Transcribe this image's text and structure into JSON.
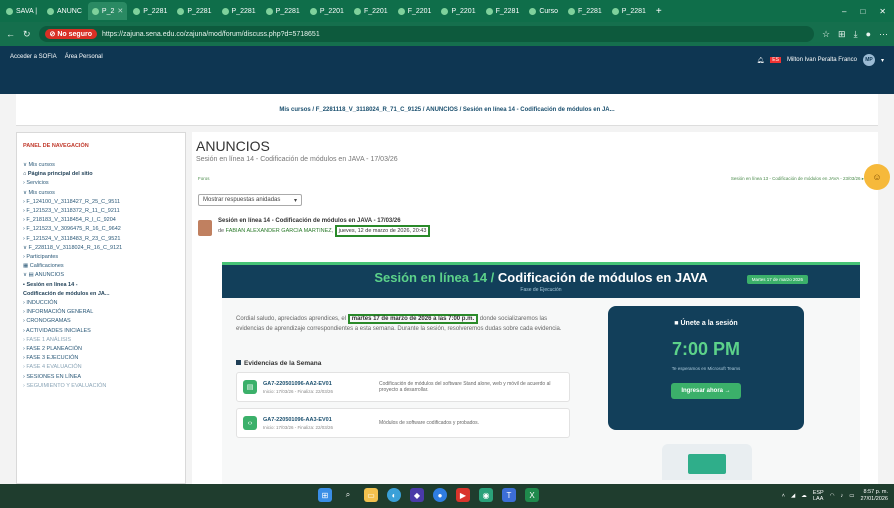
{
  "browser": {
    "tabs": [
      {
        "label": "SAVA |",
        "active": false
      },
      {
        "label": "ANUNC",
        "active": false
      },
      {
        "label": "P_2",
        "active": true
      },
      {
        "label": "P_2281",
        "active": false
      },
      {
        "label": "P_2281",
        "active": false
      },
      {
        "label": "P_2281",
        "active": false
      },
      {
        "label": "P_2281",
        "active": false
      },
      {
        "label": "P_2201",
        "active": false
      },
      {
        "label": "F_2201",
        "active": false
      },
      {
        "label": "F_2201",
        "active": false
      },
      {
        "label": "P_2201",
        "active": false
      },
      {
        "label": "F_2281",
        "active": false
      },
      {
        "label": "Curso",
        "active": false
      },
      {
        "label": "F_2281",
        "active": false
      },
      {
        "label": "P_2281",
        "active": false
      }
    ],
    "new_tab": "+",
    "window_controls": [
      "–",
      "□",
      "✕"
    ],
    "not_secure_label": "No seguro",
    "url": "https://zajuna.sena.edu.co/zajuna/mod/forum/discuss.php?d=5718651"
  },
  "moodle": {
    "top_links": [
      "Acceder a SOFIA",
      "Área Personal"
    ],
    "user_name": "Milton Ivan Peralta Franco",
    "user_initials": "MP",
    "breadcrumb": "Mis cursos / F_2281118_V_3118024_R_71_C_9125 / ANUNCIOS / Sesión en línea 14 - Codificación de módulos en JA..."
  },
  "sidebar": {
    "header": "PANEL DE NAVEGACIÓN",
    "items": [
      {
        "label": "∨ Mis cursos",
        "style": ""
      },
      {
        "label": "⌂ Página principal del sitio",
        "style": "bold"
      },
      {
        "label": "› Servicios",
        "style": ""
      },
      {
        "label": "∨ Mis cursos",
        "style": ""
      },
      {
        "label": "› F_124100_V_3118427_R_25_C_9511",
        "style": ""
      },
      {
        "label": "› F_121523_V_3118372_R_11_C_9211",
        "style": ""
      },
      {
        "label": "› F_218183_V_3118454_R_I_C_9204",
        "style": ""
      },
      {
        "label": "› F_121523_V_3096475_R_16_C_9642",
        "style": ""
      },
      {
        "label": "› F_121524_V_3118483_R_23_C_9521",
        "style": ""
      },
      {
        "label": "∨ F_228118_V_3118024_R_16_C_9121",
        "style": ""
      },
      {
        "label": "   › Participantes",
        "style": ""
      },
      {
        "label": "   ▦ Calificaciones",
        "style": ""
      },
      {
        "label": "   ∨ ▤ ANUNCIOS",
        "style": ""
      },
      {
        "label": "      ▪ Sesión en línea 14 -",
        "style": "bold"
      },
      {
        "label": "      Codificación de módulos en JA...",
        "style": "bold"
      },
      {
        "label": "   › INDUCCIÓN",
        "style": ""
      },
      {
        "label": "   › INFORMACIÓN GENERAL",
        "style": ""
      },
      {
        "label": "   › CRONOGRAMAS",
        "style": ""
      },
      {
        "label": "   › ACTIVIDADES INICIALES",
        "style": ""
      },
      {
        "label": "   › FASE 1 ANÁLISIS",
        "style": "grey"
      },
      {
        "label": "   › FASE 2 PLANEACIÓN",
        "style": ""
      },
      {
        "label": "   › FASE 3 EJECUCIÓN",
        "style": ""
      },
      {
        "label": "   › FASE 4 EVALUACIÓN",
        "style": "grey"
      },
      {
        "label": "   › SESIONES EN LÍNEA",
        "style": ""
      },
      {
        "label": "   › SEGUIMIENTO Y EVALUACIÓN",
        "style": "grey"
      }
    ]
  },
  "forum": {
    "title": "ANUNCIOS",
    "subtitle": "Sesión en línea 14 - Codificación de módulos en JAVA - 17/03/26",
    "top_left_link": "Foros",
    "top_right_link": "Sesión en línea 13 - Codificación de módulos en JAVA - 23/03/26 ▸",
    "display_mode": "Mostrar respuestas anidadas",
    "post_title": "Sesión en línea 14 - Codificación de módulos en JAVA - 17/03/26",
    "post_by_prefix": "de",
    "post_author": "FABIAN ALEXANDER GARCIA MARTINEZ",
    "post_date": "jueves, 12 de marzo de 2026, 20:43"
  },
  "banner": {
    "title_part1": "Sesión en línea 14 / ",
    "title_part2": "Codificación de módulos en JAVA",
    "subtitle": "Fase de Ejecución",
    "date_chip": "Martes 17 de marzo 2026"
  },
  "message": {
    "before": "Cordial saludo, apreciados aprendices, el ",
    "highlight": "martes 17 de marzo de 2026 a las 7:00 p.m.",
    "after": " donde socializaremos las evidencias de aprendizaje correspondientes a esta semana. Durante la sesión, resolveremos dudas sobre cada evidencia."
  },
  "evidences": {
    "title": "Evidencias de la Semana",
    "items": [
      {
        "code": "GA7-220501096-AA2-EV01",
        "dates": "Inicio: 17/03/26 - Finaliza: 22/03/26",
        "desc": "Codificación de módulos del software Stand alone, web y móvil de acuerdo al proyecto a desarrollar."
      },
      {
        "code": "GA7-220501096-AA3-EV01",
        "dates": "Inicio: 17/03/26 - Finaliza: 22/03/26",
        "desc": "Módulos de software codificados y probados."
      }
    ]
  },
  "join_card": {
    "title": "Únete a la sesión",
    "time": "7:00 PM",
    "note": "Te esperamos en Microsoft Teams",
    "button": "Ingresar ahora →"
  },
  "taskbar": {
    "lang": "ESP",
    "lang2": "LAA",
    "time": "8:57 p. m.",
    "date": "27/01/2026"
  }
}
